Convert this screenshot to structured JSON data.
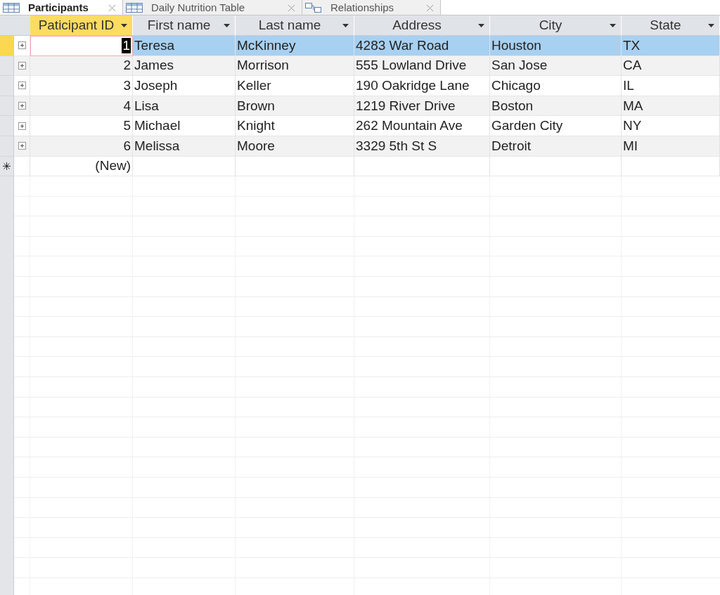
{
  "tabs": [
    {
      "label": "Participants",
      "selected": true,
      "kind": "table"
    },
    {
      "label": "Daily Nutrition Table",
      "selected": false,
      "kind": "table"
    },
    {
      "label": "Relationships",
      "selected": false,
      "kind": "relationships"
    }
  ],
  "columns": [
    {
      "label": "Paticipant ID",
      "selected": true
    },
    {
      "label": "First name",
      "selected": false
    },
    {
      "label": "Last name",
      "selected": false
    },
    {
      "label": "Address",
      "selected": false
    },
    {
      "label": "City",
      "selected": false
    },
    {
      "label": "State",
      "selected": false
    }
  ],
  "rows": [
    {
      "cells": [
        "1",
        "Teresa",
        "McKinney",
        "4283 War Road",
        "Houston",
        "TX"
      ],
      "selected": true
    },
    {
      "cells": [
        "2",
        "James",
        "Morrison",
        "555 Lowland Drive",
        "San Jose",
        "CA"
      ],
      "selected": false
    },
    {
      "cells": [
        "3",
        "Joseph",
        "Keller",
        "190 Oakridge Lane",
        "Chicago",
        "IL"
      ],
      "selected": false
    },
    {
      "cells": [
        "4",
        "Lisa",
        "Brown",
        "1219 River Drive",
        "Boston",
        "MA"
      ],
      "selected": false
    },
    {
      "cells": [
        "5",
        "Michael",
        "Knight",
        "262 Mountain Ave",
        "Garden City",
        "NY"
      ],
      "selected": false
    },
    {
      "cells": [
        "6",
        "Melissa",
        "Moore",
        "3329 5th St S",
        "Detroit",
        "MI"
      ],
      "selected": false
    }
  ],
  "new_row": {
    "id": "(New)"
  }
}
